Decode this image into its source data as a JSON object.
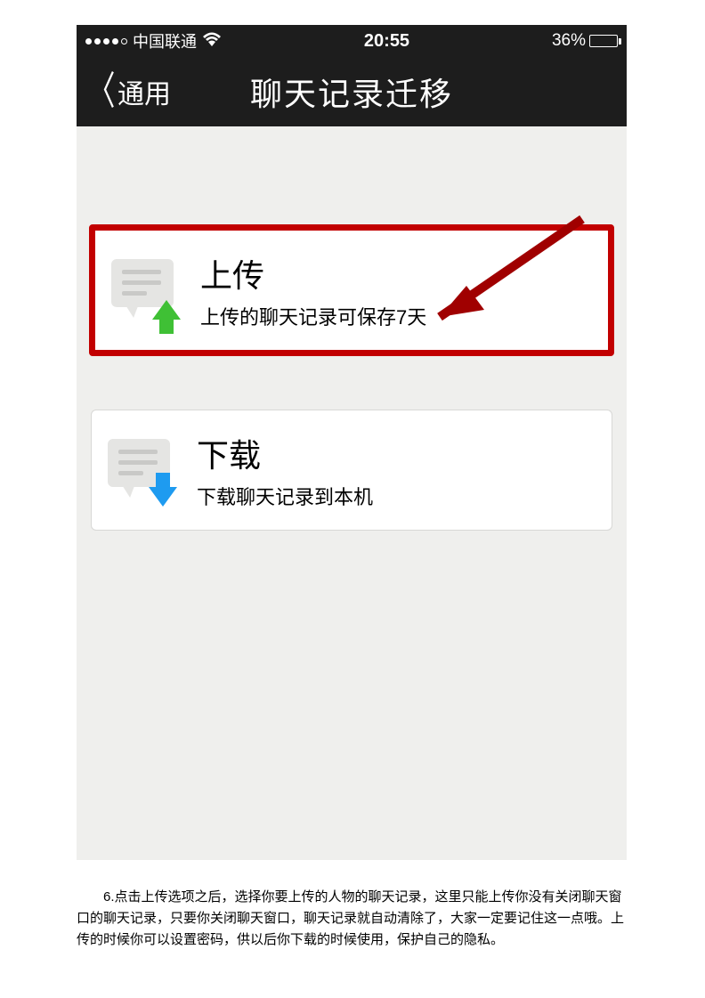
{
  "statusBar": {
    "carrier": "中国联通",
    "time": "20:55",
    "batteryPercent": "36%"
  },
  "navBar": {
    "backLabel": "通用",
    "title": "聊天记录迁移"
  },
  "options": {
    "upload": {
      "title": "上传",
      "subtitle": "上传的聊天记录可保存7天"
    },
    "download": {
      "title": "下载",
      "subtitle": "下载聊天记录到本机"
    }
  },
  "instruction": {
    "text": "6.点击上传选项之后，选择你要上传的人物的聊天记录，这里只能上传你没有关闭聊天窗口的聊天记录，只要你关闭聊天窗口，聊天记录就自动清除了，大家一定要记住这一点哦。上传的时候你可以设置密码，供以后你下载的时候使用，保护自己的隐私。"
  }
}
